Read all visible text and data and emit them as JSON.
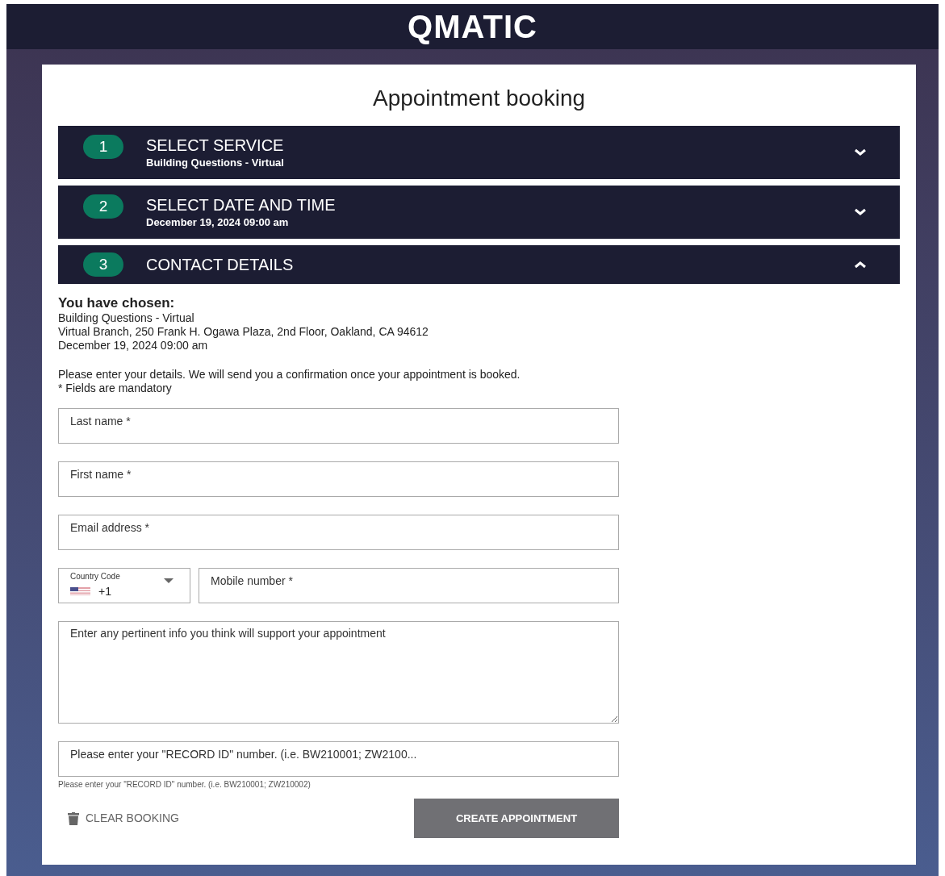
{
  "header": {
    "logo": "QMATIC"
  },
  "title": "Appointment booking",
  "steps": [
    {
      "number": "1",
      "title": "SELECT SERVICE",
      "summary": "Building Questions - Virtual",
      "expanded": false
    },
    {
      "number": "2",
      "title": "SELECT DATE AND TIME",
      "summary": "December 19, 2024 09:00 am",
      "expanded": false
    },
    {
      "number": "3",
      "title": "CONTACT DETAILS",
      "expanded": true
    }
  ],
  "chosen": {
    "heading": "You have chosen:",
    "lines": [
      "Building Questions - Virtual",
      "Virtual Branch, 250 Frank H. Ogawa Plaza, 2nd Floor, Oakland, CA 94612",
      "December 19, 2024 09:00 am"
    ]
  },
  "instructions": [
    "Please enter your details. We will send you a confirmation once your appointment is booked.",
    "* Fields are mandatory"
  ],
  "fields": [
    {
      "kind": "text",
      "placeholder": "Last name *"
    },
    {
      "kind": "text",
      "placeholder": "First name *"
    },
    {
      "kind": "text",
      "placeholder": "Email address *"
    },
    {
      "kind": "phone",
      "country_label": "Country Code",
      "country_value": "+1",
      "placeholder": "Mobile number *"
    },
    {
      "kind": "textarea",
      "placeholder": "Enter any pertinent info you think will support your appointment"
    },
    {
      "kind": "text",
      "placeholder": "Please enter your \"RECORD ID\" number. (i.e. BW210001; ZW2100...",
      "hint": "Please enter your \"RECORD ID\" number. (i.e. BW210001; ZW210002)"
    }
  ],
  "actions": {
    "clear": "CLEAR BOOKING",
    "create": "CREATE APPOINTMENT"
  }
}
